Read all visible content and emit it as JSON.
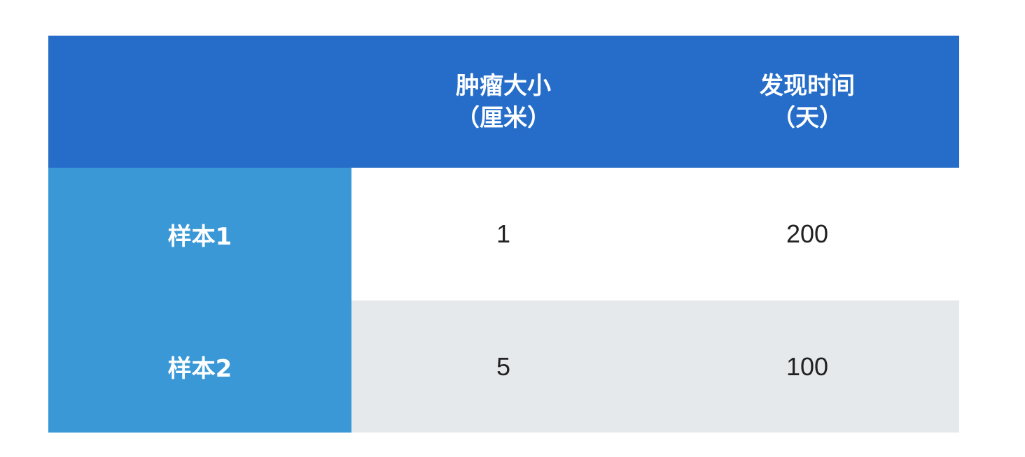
{
  "chart_data": {
    "type": "table",
    "columns": [
      {
        "line1": "",
        "line2": ""
      },
      {
        "line1": "肿瘤大小",
        "line2": "（厘米）"
      },
      {
        "line1": "发现时间",
        "line2": "（天）"
      }
    ],
    "rows": [
      {
        "label": "样本1",
        "values": [
          "1",
          "200"
        ]
      },
      {
        "label": "样本2",
        "values": [
          "5",
          "100"
        ]
      }
    ]
  },
  "colors": {
    "header_bg": "#256dc9",
    "row_label_bg": "#3a98d6",
    "row_alt_bg": "#e6e9ec",
    "text_dark": "#222222"
  }
}
